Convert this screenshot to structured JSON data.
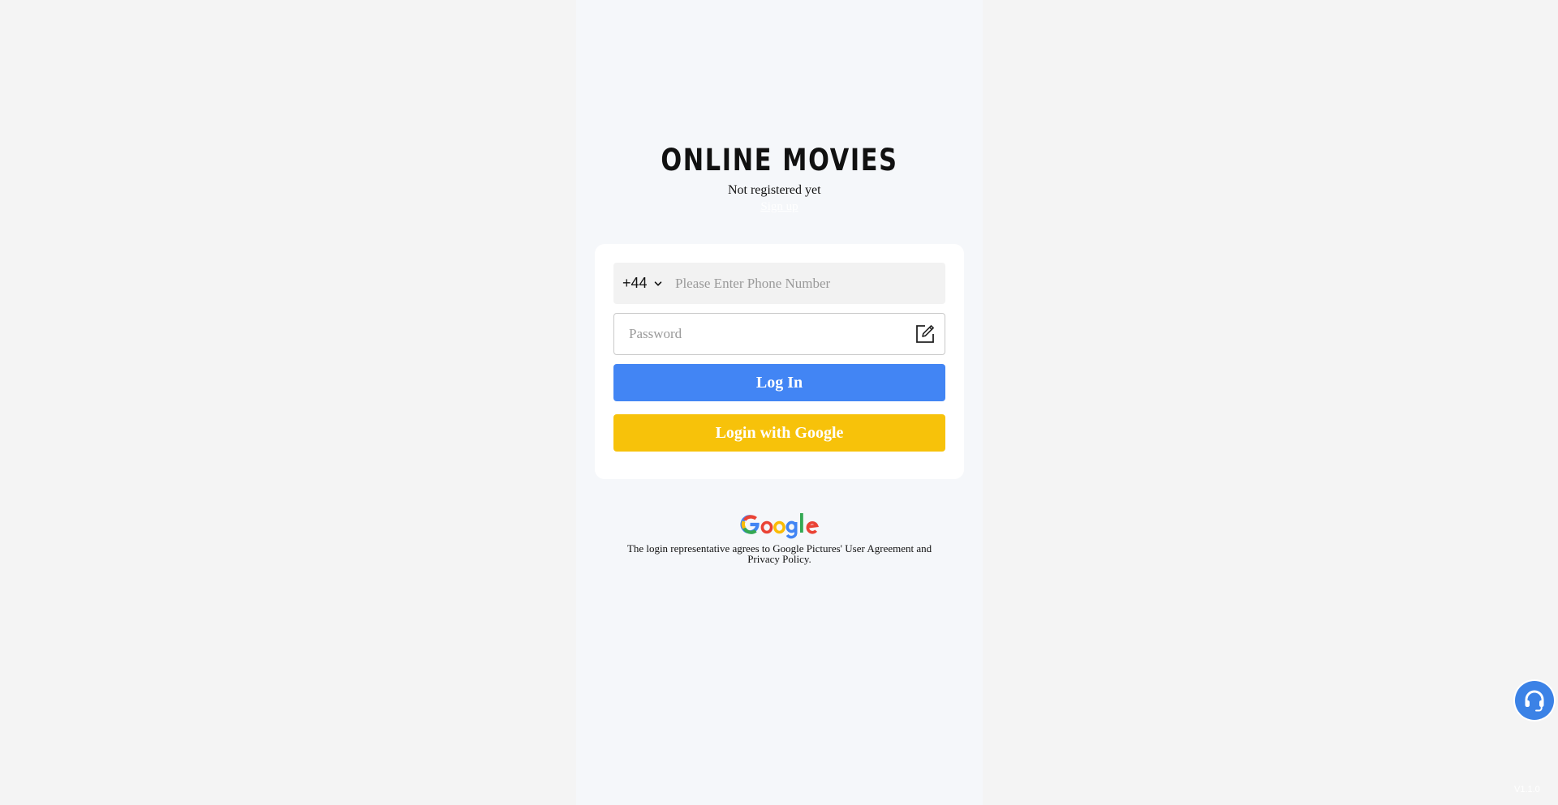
{
  "header": {
    "brand": "ONLINE MOVIES",
    "not_registered": "Not registered yet\u0000",
    "signup_link": "Sign up"
  },
  "form": {
    "country_code": "+44",
    "phone_placeholder": "Please Enter Phone Number",
    "password_placeholder": "Password",
    "login_label": "Log In",
    "google_label": "Login with Google"
  },
  "footer": {
    "agreement": "The login representative agrees to Google Pictures' User Agreement and Privacy Policy."
  },
  "version": "V1.1.0",
  "colors": {
    "login_button": "#4285f4",
    "google_button": "#f7c20a",
    "support_button": "#3b82e6"
  },
  "icons": {
    "country_dropdown": "chevron-down-icon",
    "password_edit": "edit-icon",
    "support": "headset-icon",
    "google_logo": "google-logo"
  }
}
